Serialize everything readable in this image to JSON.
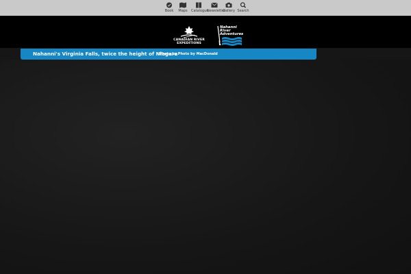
{
  "nav": {
    "items": [
      {
        "label": "Book",
        "icon": "check-circle-icon"
      },
      {
        "label": "Maps",
        "icon": "map-icon"
      },
      {
        "label": "Catalogue",
        "icon": "book-icon"
      },
      {
        "label": "Newsletter",
        "icon": "envelope-icon"
      },
      {
        "label": "Gallery",
        "icon": "camera-icon"
      },
      {
        "label": "Search",
        "icon": "search-icon"
      }
    ]
  },
  "header": {
    "logo_left": {
      "line1": "CANADIAN RIVER",
      "line2": "EXPEDITIONS"
    },
    "logo_right": {
      "line1": "Nahanni",
      "line2": "River",
      "line3": "Adventures"
    }
  },
  "caption": {
    "title": "Nahanni's Virginia Falls, twice the height of Niagara",
    "credit": "Photo by Photo by MacDonald"
  },
  "colors": {
    "nav_bg": "#c9c9c9",
    "header_bg": "#000000",
    "caption_bg": "#1687c4",
    "hero_bg": "#1a1a1a"
  }
}
